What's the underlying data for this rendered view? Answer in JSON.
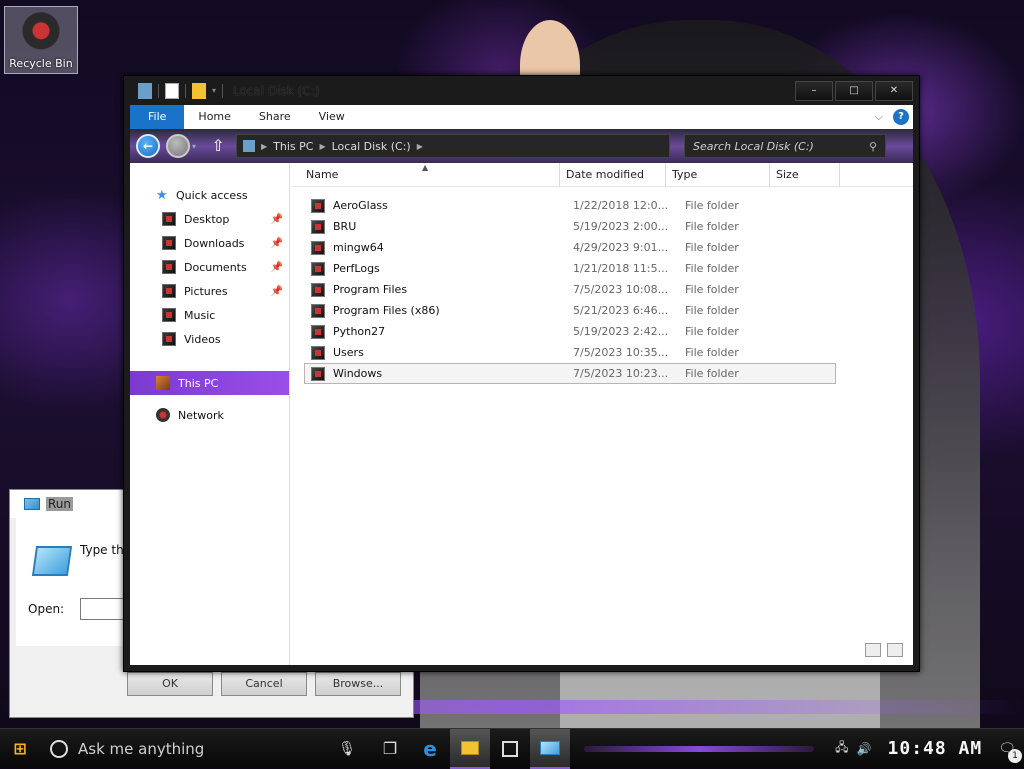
{
  "desktop": {
    "recycle_bin_label": "Recycle Bin"
  },
  "run_dialog": {
    "title": "Run",
    "description": "Type the name of a program, folder, document, or Internet resource, and Windows will open it for you.",
    "open_label": "Open:",
    "open_value": "",
    "ok_label": "OK",
    "cancel_label": "Cancel",
    "browse_label": "Browse..."
  },
  "explorer": {
    "title": "Local Disk (C:)",
    "window_buttons": {
      "minimize": "–",
      "maximize": "□",
      "close": "✕"
    },
    "ribbon_tabs": [
      "File",
      "Home",
      "Share",
      "View"
    ],
    "help_label": "?",
    "breadcrumb": [
      "This PC",
      "Local Disk (C:)"
    ],
    "search_placeholder": "Search Local Disk (C:)",
    "sidebar": {
      "quick_access": "Quick access",
      "quick_items": [
        "Desktop",
        "Downloads",
        "Documents",
        "Pictures",
        "Music",
        "Videos"
      ],
      "this_pc": "This PC",
      "network": "Network"
    },
    "columns": {
      "name": "Name",
      "date": "Date modified",
      "type": "Type",
      "size": "Size"
    },
    "files": [
      {
        "name": "AeroGlass",
        "date": "1/22/2018 12:0...",
        "type": "File folder"
      },
      {
        "name": "BRU",
        "date": "5/19/2023 2:00...",
        "type": "File folder"
      },
      {
        "name": "mingw64",
        "date": "4/29/2023 9:01...",
        "type": "File folder"
      },
      {
        "name": "PerfLogs",
        "date": "1/21/2018 11:5...",
        "type": "File folder"
      },
      {
        "name": "Program Files",
        "date": "7/5/2023 10:08...",
        "type": "File folder"
      },
      {
        "name": "Program Files (x86)",
        "date": "5/21/2023 6:46...",
        "type": "File folder"
      },
      {
        "name": "Python27",
        "date": "5/19/2023 2:42...",
        "type": "File folder"
      },
      {
        "name": "Users",
        "date": "7/5/2023 10:35...",
        "type": "File folder"
      },
      {
        "name": "Windows",
        "date": "7/5/2023 10:23...",
        "type": "File folder"
      }
    ],
    "selected_file": "Windows"
  },
  "taskbar": {
    "search_placeholder": "Ask me anything",
    "clock": "10:48 AM",
    "notification_count": "1"
  }
}
